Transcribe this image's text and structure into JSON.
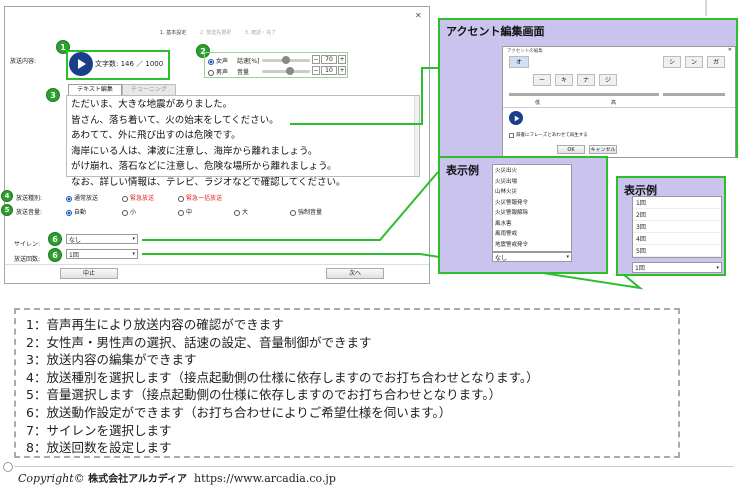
{
  "dialog": {
    "steps": [
      "1. 基本設定",
      "2. 放送先選択",
      "3. 確認・完了"
    ],
    "close_icon": "close-icon",
    "broadcast_content_label": "放送内容:",
    "char_count": "文字数: 146 ／ 1000",
    "voice": {
      "female": "女声",
      "male": "男声",
      "speed_label": "話速[%]",
      "speed_value": "70",
      "volume_label": "音量",
      "volume_value": "10"
    },
    "tabs": {
      "text_edit": "テキスト編集",
      "tuning": "チューニング"
    },
    "broadcast_text": [
      "ただいま、大きな地震がありました。",
      "皆さん、落ち着いて、火の始末をしてください。",
      "あわてて、外に飛び出すのは危険です。",
      "海岸にいる人は、津波に注意し、海岸から離れましょう。",
      "がけ崩れ、落石などに注意し、危険な場所から離れましょう。",
      "なお、詳しい情報は、テレビ、ラジオなどで確認してください。"
    ],
    "type_label": "放送種別:",
    "types": [
      "通常放送",
      "緊急放送",
      "緊急一括放送"
    ],
    "volume_label": "放送音量:",
    "volumes": [
      "自動",
      "小",
      "中",
      "大",
      "強制音量"
    ],
    "siren_label": "サイレン:",
    "siren_value": "なし",
    "count_label": "放送回数:",
    "count_value": "1回",
    "cancel_button": "中止",
    "next_button": "次へ",
    "markers": [
      "1",
      "2",
      "3",
      "4",
      "5",
      "6",
      "6"
    ]
  },
  "accent_panel": {
    "title": "アクセント編集画面",
    "window_title": "アクセントの編集",
    "keys_top": [
      "オ",
      "シ",
      "ン",
      "ガ"
    ],
    "keys_mid": [
      "ー",
      "キ",
      "ナ",
      "ジ"
    ],
    "low_label": "低",
    "high_label": "高",
    "checkbox_label": "辞書にフレーズとあわせて再生する",
    "ok": "OK",
    "cancel": "キャンセル"
  },
  "example1": {
    "title": "表示例",
    "items": [
      "火災出火",
      "火災出場",
      "山林火災",
      "火災警報発令",
      "火災警報解除",
      "風水害",
      "風雨警戒",
      "地震警戒発令"
    ],
    "selected": "なし"
  },
  "example2": {
    "title": "表示例",
    "items": [
      "1回",
      "2回",
      "3回",
      "4回",
      "5回"
    ],
    "selected": "1回"
  },
  "notes": [
    "1：音声再生により放送内容の確認ができます",
    "2：女性声・男性声の選択、話速の設定、音量制御ができます",
    "3：放送内容の編集ができます",
    "4：放送種別を選択します（接点起動側の仕様に依存しますのでお打ち合わせとなります。）",
    "5：音量選択します（接点起動側の仕様に依存しますのでお打ち合わせとなります。）",
    "6：放送動作設定ができます（お打ち合わせによりご希望仕様を伺います。）",
    "7：サイレンを選択します",
    "8：放送回数を設定します"
  ],
  "copyright": {
    "prefix": "Copyright© ",
    "company": "株式会社アルカディア",
    "url": "https://www.arcadia.co.jp"
  },
  "colors": {
    "accent_green": "#2dbd2d",
    "panel_purple": "#c9c3ee",
    "play_blue": "#1b3e8a",
    "urgent_red": "#d22"
  }
}
